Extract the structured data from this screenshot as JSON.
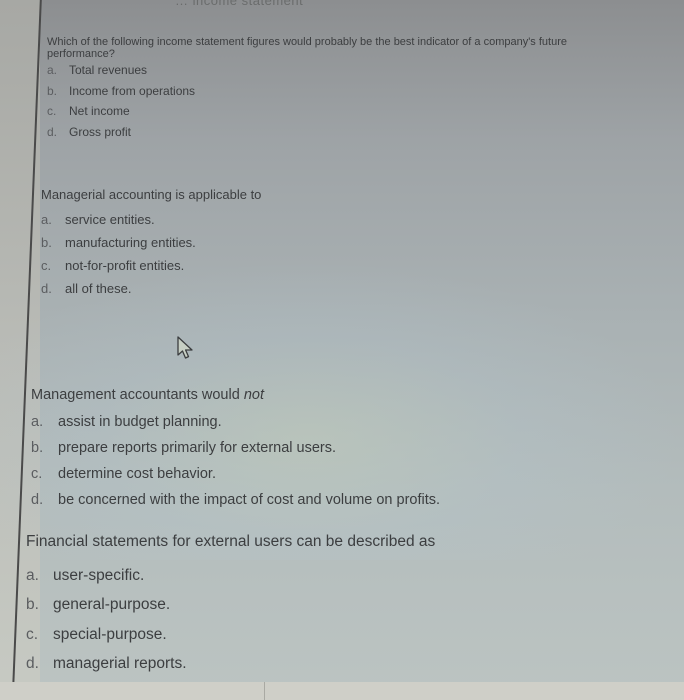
{
  "header": {
    "partial_title": "… income statement"
  },
  "questions": [
    {
      "stem": "Which of the following income statement figures would probably be the best indicator of a company's future performance?",
      "options": [
        {
          "letter": "a.",
          "text": "Total revenues"
        },
        {
          "letter": "b.",
          "text": "Income from operations"
        },
        {
          "letter": "c.",
          "text": "Net income"
        },
        {
          "letter": "d.",
          "text": "Gross profit"
        }
      ]
    },
    {
      "stem": "Managerial accounting is applicable to",
      "options": [
        {
          "letter": "a.",
          "text": "service entities."
        },
        {
          "letter": "b.",
          "text": "manufacturing entities."
        },
        {
          "letter": "c.",
          "text": "not-for-profit entities."
        },
        {
          "letter": "d.",
          "text": "all of these."
        }
      ]
    },
    {
      "stem": "Management accountants would ",
      "stem_emphasis": "not",
      "options": [
        {
          "letter": "a.",
          "text": "assist in budget planning."
        },
        {
          "letter": "b.",
          "text": "prepare reports primarily for external users."
        },
        {
          "letter": "c.",
          "text": "determine cost behavior."
        },
        {
          "letter": "d.",
          "text": "be concerned with the impact of cost and volume on profits."
        }
      ]
    },
    {
      "stem": "Financial statements for external users can be described as",
      "options": [
        {
          "letter": "a.",
          "text": "user-specific."
        },
        {
          "letter": "b.",
          "text": "general-purpose."
        },
        {
          "letter": "c.",
          "text": "special-purpose."
        },
        {
          "letter": "d.",
          "text": "managerial reports."
        }
      ]
    }
  ],
  "cursor": {
    "icon": "mouse-pointer-icon"
  }
}
